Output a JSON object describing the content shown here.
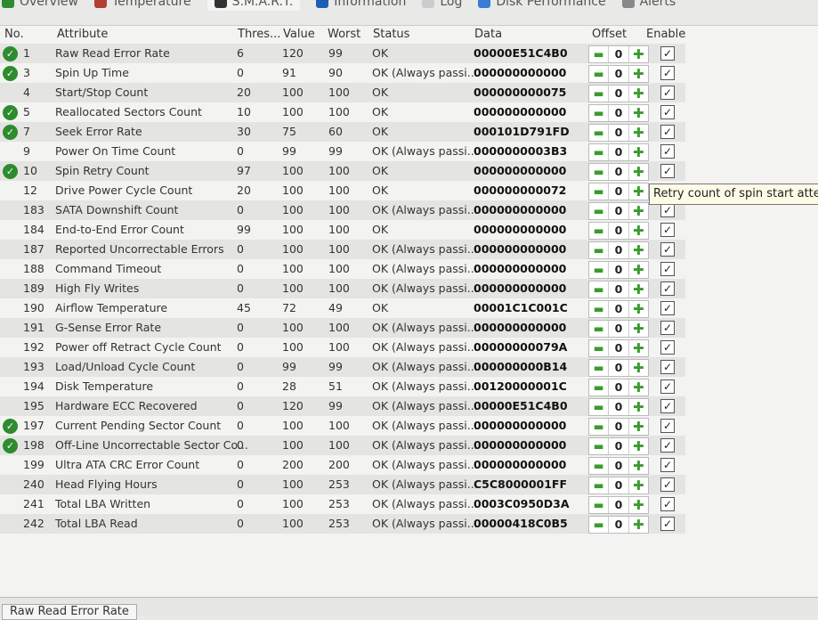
{
  "tabs": [
    {
      "label": "Overview",
      "icon": "check-icon"
    },
    {
      "label": "Temperature",
      "icon": "thermometer-icon"
    },
    {
      "label": "S.M.A.R.T.",
      "icon": "smart-icon"
    },
    {
      "label": "Information",
      "icon": "info-icon"
    },
    {
      "label": "Log",
      "icon": "log-icon"
    },
    {
      "label": "Disk Performance",
      "icon": "chart-icon"
    },
    {
      "label": "Alerts",
      "icon": "alert-icon"
    }
  ],
  "columns": {
    "no": "No.",
    "attribute": "Attribute",
    "threshold": "Thres...",
    "value": "Value",
    "worst": "Worst",
    "status": "Status",
    "data": "Data",
    "offset": "Offset",
    "enable": "Enable"
  },
  "rows": [
    {
      "no": "1",
      "attr": "Raw Read Error Rate",
      "thr": "6",
      "val": "120",
      "worst": "99",
      "status": "OK",
      "data": "00000E51C4B0",
      "check": true
    },
    {
      "no": "3",
      "attr": "Spin Up Time",
      "thr": "0",
      "val": "91",
      "worst": "90",
      "status": "OK (Always passi...",
      "data": "000000000000",
      "check": true
    },
    {
      "no": "4",
      "attr": "Start/Stop Count",
      "thr": "20",
      "val": "100",
      "worst": "100",
      "status": "OK",
      "data": "000000000075",
      "check": false
    },
    {
      "no": "5",
      "attr": "Reallocated Sectors Count",
      "thr": "10",
      "val": "100",
      "worst": "100",
      "status": "OK",
      "data": "000000000000",
      "check": true
    },
    {
      "no": "7",
      "attr": "Seek Error Rate",
      "thr": "30",
      "val": "75",
      "worst": "60",
      "status": "OK",
      "data": "000101D791FD",
      "check": true
    },
    {
      "no": "9",
      "attr": "Power On Time Count",
      "thr": "0",
      "val": "99",
      "worst": "99",
      "status": "OK (Always passi...",
      "data": "0000000003B3",
      "check": false
    },
    {
      "no": "10",
      "attr": "Spin Retry Count",
      "thr": "97",
      "val": "100",
      "worst": "100",
      "status": "OK",
      "data": "000000000000",
      "check": true
    },
    {
      "no": "12",
      "attr": "Drive Power Cycle Count",
      "thr": "20",
      "val": "100",
      "worst": "100",
      "status": "OK",
      "data": "000000000072",
      "check": false
    },
    {
      "no": "183",
      "attr": "SATA Downshift Count",
      "thr": "0",
      "val": "100",
      "worst": "100",
      "status": "OK (Always passi...",
      "data": "000000000000",
      "check": false
    },
    {
      "no": "184",
      "attr": "End-to-End Error Count",
      "thr": "99",
      "val": "100",
      "worst": "100",
      "status": "OK",
      "data": "000000000000",
      "check": false
    },
    {
      "no": "187",
      "attr": "Reported Uncorrectable Errors",
      "thr": "0",
      "val": "100",
      "worst": "100",
      "status": "OK (Always passi...",
      "data": "000000000000",
      "check": false
    },
    {
      "no": "188",
      "attr": "Command Timeout",
      "thr": "0",
      "val": "100",
      "worst": "100",
      "status": "OK (Always passi...",
      "data": "000000000000",
      "check": false
    },
    {
      "no": "189",
      "attr": "High Fly Writes",
      "thr": "0",
      "val": "100",
      "worst": "100",
      "status": "OK (Always passi...",
      "data": "000000000000",
      "check": false
    },
    {
      "no": "190",
      "attr": "Airflow Temperature",
      "thr": "45",
      "val": "72",
      "worst": "49",
      "status": "OK",
      "data": "00001C1C001C",
      "check": false
    },
    {
      "no": "191",
      "attr": "G-Sense Error Rate",
      "thr": "0",
      "val": "100",
      "worst": "100",
      "status": "OK (Always passi...",
      "data": "000000000000",
      "check": false
    },
    {
      "no": "192",
      "attr": "Power off Retract Cycle Count",
      "thr": "0",
      "val": "100",
      "worst": "100",
      "status": "OK (Always passi...",
      "data": "00000000079A",
      "check": false
    },
    {
      "no": "193",
      "attr": "Load/Unload Cycle Count",
      "thr": "0",
      "val": "99",
      "worst": "99",
      "status": "OK (Always passi...",
      "data": "000000000B14",
      "check": false
    },
    {
      "no": "194",
      "attr": "Disk Temperature",
      "thr": "0",
      "val": "28",
      "worst": "51",
      "status": "OK (Always passi...",
      "data": "00120000001C",
      "check": false
    },
    {
      "no": "195",
      "attr": "Hardware ECC Recovered",
      "thr": "0",
      "val": "120",
      "worst": "99",
      "status": "OK (Always passi...",
      "data": "00000E51C4B0",
      "check": false
    },
    {
      "no": "197",
      "attr": "Current Pending Sector Count",
      "thr": "0",
      "val": "100",
      "worst": "100",
      "status": "OK (Always passi...",
      "data": "000000000000",
      "check": true
    },
    {
      "no": "198",
      "attr": "Off-Line Uncorrectable Sector Co...",
      "thr": "0",
      "val": "100",
      "worst": "100",
      "status": "OK (Always passi...",
      "data": "000000000000",
      "check": true
    },
    {
      "no": "199",
      "attr": "Ultra ATA CRC Error Count",
      "thr": "0",
      "val": "200",
      "worst": "200",
      "status": "OK (Always passi...",
      "data": "000000000000",
      "check": false
    },
    {
      "no": "240",
      "attr": "Head Flying Hours",
      "thr": "0",
      "val": "100",
      "worst": "253",
      "status": "OK (Always passi...",
      "data": "C5C8000001FF",
      "check": false
    },
    {
      "no": "241",
      "attr": "Total LBA Written",
      "thr": "0",
      "val": "100",
      "worst": "253",
      "status": "OK (Always passi...",
      "data": "0003C0950D3A",
      "check": false
    },
    {
      "no": "242",
      "attr": "Total LBA Read",
      "thr": "0",
      "val": "100",
      "worst": "253",
      "status": "OK (Always passi...",
      "data": "00000418C0B5",
      "check": false
    }
  ],
  "offset_value": "0",
  "tooltip": "Retry count of spin start atten",
  "bottom_tab": "Raw Read Error Rate"
}
